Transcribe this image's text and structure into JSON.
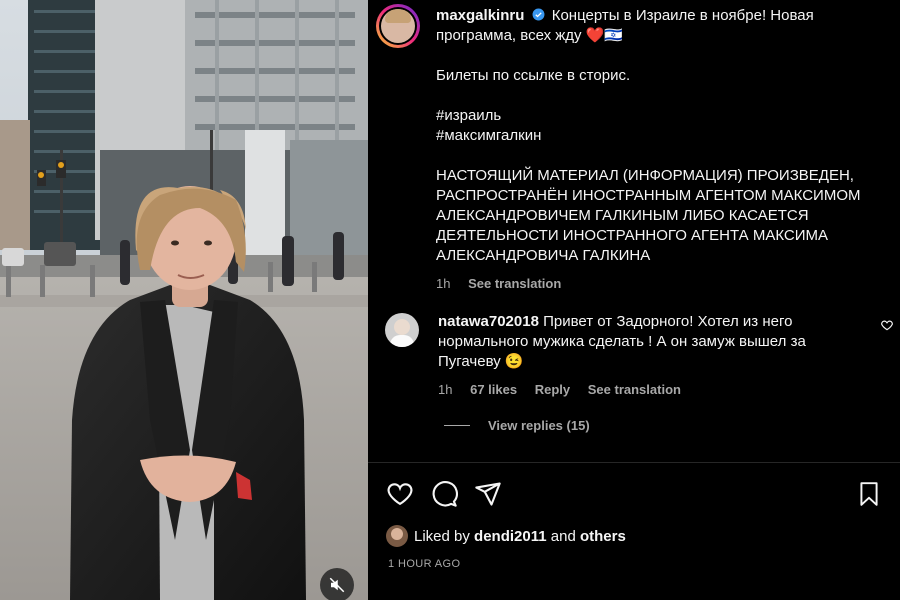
{
  "post": {
    "author": "maxgalkinru",
    "caption_line1": "Концерты в Израиле в ноябре! Новая программа, всех жду",
    "caption_emoji": "❤️🇮🇱",
    "tickets": "Билеты по ссылке в сторис.",
    "tag1": "#израиль",
    "tag2": "#максимгалкин",
    "disclaimer": "НАСТОЯЩИЙ МАТЕРИАЛ (ИНФОРМАЦИЯ) ПРОИЗВЕДЕН, РАСПРОСТРАНЁН ИНОСТРАННЫМ АГЕНТОМ МАКСИМОМ АЛЕКСАНДРОВИЧЕМ ГАЛКИНЫМ ЛИБО КАСАЕТСЯ ДЕЯТЕЛЬНОСТИ ИНОСТРАННОГО АГЕНТА МАКСИМА АЛЕКСАНДРОВИЧА ГАЛКИНА",
    "time": "1h",
    "see_translation": "See translation",
    "verified_icon": "verified-badge-icon"
  },
  "comment": {
    "author": "natawa702018",
    "text": "Привет от Задорного! Хотел из него нормального мужика сделать ! А он замуж вышел за Пугачеву 😉",
    "time": "1h",
    "likes": "67 likes",
    "reply": "Reply",
    "see_translation": "See translation",
    "view_replies": "View replies (15)"
  },
  "footer": {
    "liked_prefix": "Liked by",
    "liked_user": "dendi2011",
    "liked_and": "and",
    "liked_others": "others",
    "time_ago": "1 HOUR AGO"
  },
  "icons": [
    "heart-icon",
    "comment-icon",
    "share-icon",
    "bookmark-icon",
    "mute-icon",
    "small-heart-icon"
  ],
  "colors": {
    "background": "#000000",
    "text": "#f5f5f5",
    "secondary": "#a8a8a8",
    "verified": "#3897f0"
  }
}
